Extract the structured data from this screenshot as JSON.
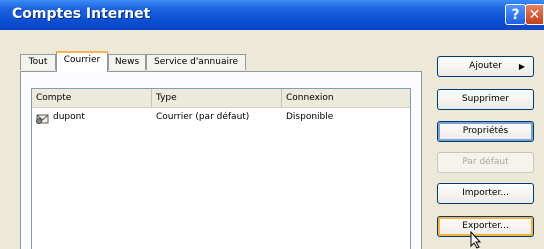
{
  "window": {
    "title": "Comptes Internet"
  },
  "titlebar_buttons": {
    "help": "?",
    "close": "✕"
  },
  "tabs": [
    {
      "label": "Tout",
      "active": false
    },
    {
      "label": "Courrier",
      "active": true
    },
    {
      "label": "News",
      "active": false
    },
    {
      "label": "Service d'annuaire",
      "active": false
    }
  ],
  "accounts_list": {
    "columns": [
      "Compte",
      "Type",
      "Connexion"
    ],
    "rows": [
      {
        "account": "dupont",
        "type": "Courrier (par défaut)",
        "connection": "Disponible"
      }
    ]
  },
  "buttons": {
    "add": "Ajouter",
    "remove": "Supprimer",
    "properties": "Propriétés",
    "set_default": "Par défaut",
    "import": "Importer...",
    "export": "Exporter..."
  },
  "icons": {
    "help": "question-mark-icon",
    "close": "close-icon",
    "account": "mail-account-icon",
    "menu_arrow": "triangle-right-icon",
    "cursor": "mouse-pointer-icon"
  },
  "colors": {
    "titlebar": "#0a4fd2",
    "dialog_bg": "#ece9d8",
    "active_tab_accent": "#f7b64b",
    "close_button": "#c2401b"
  }
}
